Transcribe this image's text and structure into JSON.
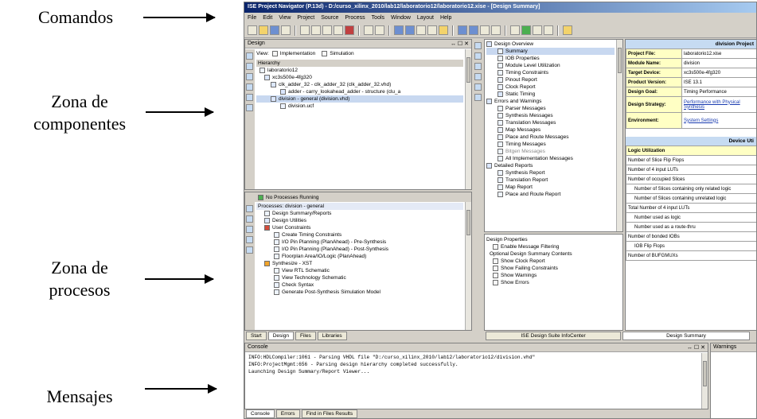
{
  "annotations": {
    "comandos": "Comandos",
    "zona_componentes_line1": "Zona de",
    "zona_componentes_line2": "componentes",
    "zona_procesos_line1": "Zona de",
    "zona_procesos_line2": "procesos",
    "mensajes": "Mensajes"
  },
  "window": {
    "title": "ISE Project Navigator (P.13d) - D:/curso_xilinx_2010/lab12/laboratorio12/laboratorio12.xise - [Design Summary]"
  },
  "menu": [
    "File",
    "Edit",
    "View",
    "Project",
    "Source",
    "Process",
    "Tools",
    "Window",
    "Layout",
    "Help"
  ],
  "design_panel": {
    "title": "Design",
    "view_label": "View:",
    "implementation_label": "Implementation",
    "simulation_label": "Simulation",
    "hierarchy_label": "Hierarchy",
    "tree": [
      "laboratorio12",
      "xc3s500e-4fg320",
      "clk_adder_32 - clk_adder_32 (clk_adder_32.vhd)",
      "adder - carry_lookahead_adder - structure (clu_a",
      "division - general (division.vhd)",
      "division.ucf"
    ]
  },
  "processes_panel": {
    "status": "No Processes Running",
    "header": "Processes: division - general",
    "items": [
      "Design Summary/Reports",
      "Design Utilities",
      "User Constraints",
      "Create Timing Constraints",
      "I/O Pin Planning (PlanAhead) - Pre-Synthesis",
      "I/O Pin Planning (PlanAhead) - Post-Synthesis",
      "Floorplan Area/IO/Logic (PlanAhead)",
      "Synthesize - XST",
      "View RTL Schematic",
      "View Technology Schematic",
      "Check Syntax",
      "Generate Post-Synthesis Simulation Model"
    ]
  },
  "left_tabs": [
    "Start",
    "Design",
    "Files",
    "Libraries"
  ],
  "overview": {
    "items": [
      "Design Overview",
      "Summary",
      "IOB Properties",
      "Module Level Utilization",
      "Timing Constraints",
      "Pinout Report",
      "Clock Report",
      "Static Timing",
      "Errors and Warnings",
      "Parser Messages",
      "Synthesis Messages",
      "Translation Messages",
      "Map Messages",
      "Place and Route Messages",
      "Timing Messages",
      "Bitgen Messages",
      "All Implementation Messages",
      "Detailed Reports",
      "Synthesis Report",
      "Translation Report",
      "Map Report",
      "Place and Route Report"
    ],
    "properties_title": "Design Properties",
    "properties": [
      "Enable Message Filtering",
      "Optional Design Summary Contents",
      "Show Clock Report",
      "Show Failing Constraints",
      "Show Warnings",
      "Show Errors"
    ],
    "tab_infocenter": "ISE Design Suite InfoCenter",
    "tab_summary": "Design Summary"
  },
  "summary_table": {
    "heading": "division Project",
    "rows": [
      {
        "k": "Project File:",
        "v": "laboratorio12.xise"
      },
      {
        "k": "Module Name:",
        "v": "division"
      },
      {
        "k": "Target Device:",
        "v": "xc3s500e-4fg320"
      },
      {
        "k": "Product Version:",
        "v": "ISE 13.1"
      },
      {
        "k": "Design Goal:",
        "v": "Timing Performance"
      },
      {
        "k": "Design Strategy:",
        "v": "Performance with Physical Synthesis"
      },
      {
        "k": "Environment:",
        "v": "System Settings"
      }
    ],
    "device_heading": "Device Uti",
    "util_rows": [
      "Logic Utilization",
      "Number of Slice Flip Flops",
      "Number of 4 input LUTs",
      "Number of occupied Slices",
      "Number of Slices containing only related logic",
      "Number of Slices containing unrelated logic",
      "Total Number of 4 input LUTs",
      "Number used as logic",
      "Number used as a route-thru",
      "Number of bonded IOBs",
      "IOB Flip Flops",
      "Number of BUFGMUXs"
    ]
  },
  "console": {
    "title": "Console",
    "lines": [
      "INFO:HDLCompiler:1061 - Parsing VHDL file \"D:/curso_xilinx_2010/lab12/laboratorio12/division.vhd\"",
      "INFO:ProjectMgmt:656 - Parsing design hierarchy completed successfully.",
      "Launching Design Summary/Report Viewer..."
    ],
    "warnings_title": "Warnings",
    "tabs": [
      "Console",
      "Errors",
      "Find in Files Results"
    ]
  }
}
